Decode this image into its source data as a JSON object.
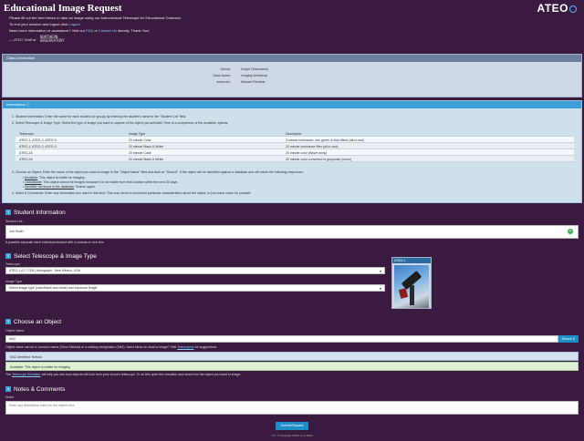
{
  "header": {
    "title": "Educational Image Request",
    "brand": "ATEO",
    "intro_line1": "Please fill out the form below to take an image using our Astronomical Telescope for Educational Outreach.",
    "intro_line2_pre": "To end your session and logout click ",
    "intro_line2_link": "Logout",
    "intro_line3_pre": "Need more information or assistance? Visit our ",
    "intro_line3_faq": "FAQ",
    "intro_line3_mid": " or ",
    "intro_line3_contact": "Contact Us",
    "intro_line3_post": " directly. Thank You!",
    "signature": "— ATEO Staff at",
    "obs_logo_top": "NORTHERN",
    "obs_logo_bottom": "OBSERVATORY"
  },
  "class_info": {
    "heading": "Class Information",
    "rows": [
      {
        "label": "School:",
        "value": "Knight Observatory"
      },
      {
        "label": "Class Name:",
        "value": "Imaging Workshop"
      },
      {
        "label": "Instructor:",
        "value": "Michael Pelsaldo"
      }
    ]
  },
  "instructions": {
    "heading": "Instructions",
    "step1": "1. Student Information: Enter the name for each student (or group) by entering the student's name in the \"Student List\" field.",
    "step2": "2. Select Telescope & Image Type: Select the type of image you want to capture of the object you selected. Here is a comparison of the available options:",
    "table_headers": [
      "Telescope",
      "Image Type",
      "Description"
    ],
    "table_rows": [
      [
        "ATEO-1, ATEO-2, ATEO-3",
        "20 minute Color",
        "3 minute luminance, red, green & blue filters (all-in-one)"
      ],
      [
        "ATEO-1, ATEO-2, ATEO-3",
        "20 minute Black & White",
        "20 minute luminance filter (all-in-one)"
      ],
      [
        "ATEO-2A",
        "20 minute Color",
        "20 minute color (Bayer array)"
      ],
      [
        "ATEO-2A",
        "20 minute Black & White",
        "20 minute color converted to grayscale (mono)"
      ]
    ],
    "step3": "3. Choose an Object: Enter the name of the object you want to image in the \"Object Name\" field and click on \"Search\". If the object will be identified against a database and will return the following responses:",
    "bullet1_key": "Available",
    "bullet1_text": ": This object is visible for imaging.",
    "bullet2_key": "Unavailable",
    "bullet2_text": ": This object cannot be imaged because it is not visible from this location within the next 30 days.",
    "bullet3_key": "Identifier not found in the database",
    "bullet3_text": ": Search again.",
    "step4": "4. Notes & Comments: Enter any information you want in this field. This may serve to document particular characteristics about the object, or just some notes for yourself."
  },
  "student": {
    "num": "1",
    "heading": "Student Information",
    "label": "Student List",
    "value": "Joe Smith",
    "hint": "If possible separate each individual student with a comma or new line."
  },
  "telescope": {
    "num": "2",
    "heading": "Select Telescope & Image Type",
    "scope_label": "Telescope",
    "scope_value": "ATEO-1 (0.7 CDK) Astrograph - New Mexico, USA",
    "type_label": "Image Type",
    "type_value": "Select image type (color/black and white) and exposure length",
    "thumb_title": "ATEO-1"
  },
  "object": {
    "num": "3",
    "heading": "Choose an Object",
    "label": "Object Name",
    "value": "M42",
    "search_label": "Search",
    "hint_pre": "Object name can be a common name (Orion Nebula) or a catalog designation (M42). Need ideas on what to image? Visit ",
    "hint_link": "Telescopius",
    "hint_post": " for suggestions.",
    "alert_blue": "M42 identified: Nebula",
    "alert_green": "Available: This object is visible for imaging.",
    "sim_pre": "The ",
    "sim_link": "Telescope Simulator",
    "sim_post": " will help you see how objects will look from your chosen telescope. To do this open the simulator and search for the object you want to image."
  },
  "notes": {
    "num": "4",
    "heading": "Notes & Comments",
    "label": "Notes",
    "placeholder": "Enter any descriptive notes for the object here"
  },
  "submit_label": "Submit Request",
  "footer": {
    "social": "f  ✆",
    "copyright": "© Copyright ATEO, LLC 2024"
  },
  "colors": {
    "background": "#3a1a3e",
    "accent": "#1e8ec8",
    "instructions_head": "#3b9fd8",
    "class_head": "#6c7f9e"
  }
}
